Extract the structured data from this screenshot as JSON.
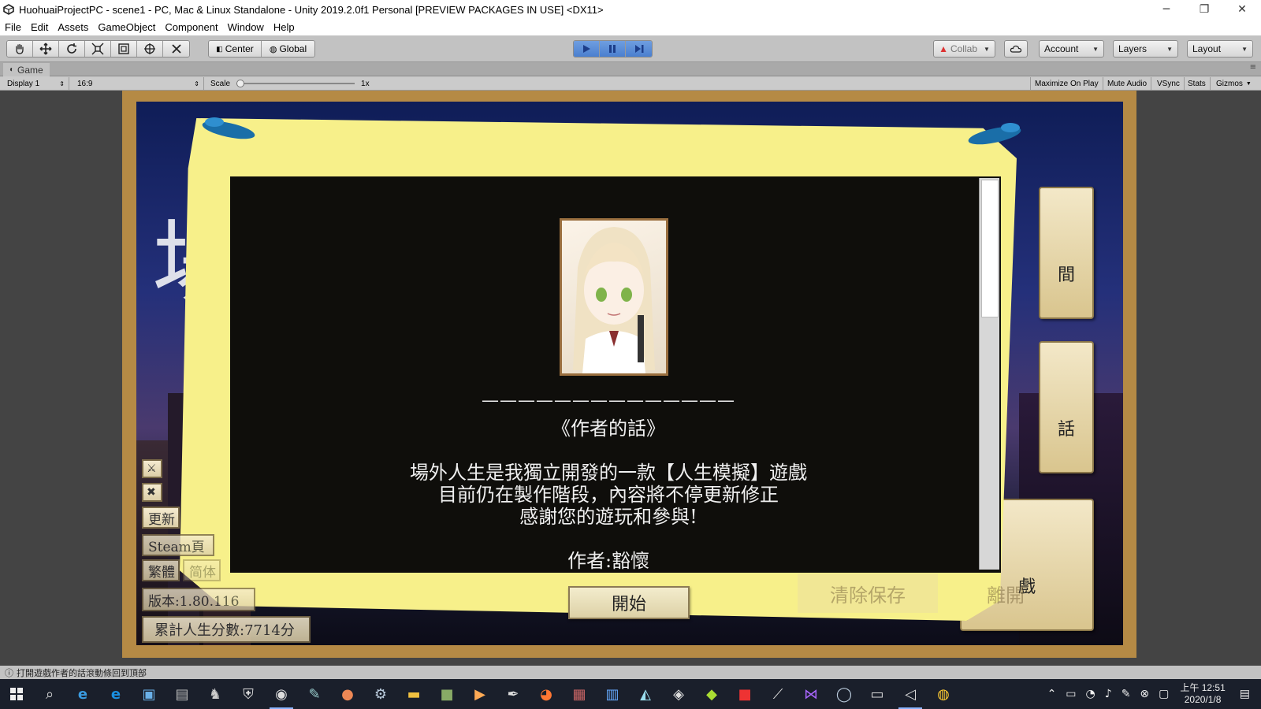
{
  "window": {
    "title": "HuohuaiProjectPC - scene1 - PC, Mac & Linux Standalone - Unity 2019.2.0f1 Personal [PREVIEW PACKAGES IN USE] <DX11>",
    "minimize": "─",
    "restore": "❐",
    "close": "✕"
  },
  "menu": [
    "File",
    "Edit",
    "Assets",
    "GameObject",
    "Component",
    "Window",
    "Help"
  ],
  "toolbar": {
    "tools": [
      "hand-tool",
      "move-tool",
      "rotate-tool",
      "scale-tool",
      "rect-tool",
      "transform-tool",
      "custom-tool"
    ],
    "pivot_label": "Center",
    "space_label": "Global",
    "collab_label": "Collab",
    "account_label": "Account",
    "layers_label": "Layers",
    "layout_label": "Layout",
    "play_state": "playing"
  },
  "game_tab": {
    "label": "Game",
    "display": "Display 1",
    "aspect": "16:9",
    "scale_label": "Scale",
    "scale_value": "1x",
    "options": [
      "Maximize On Play",
      "Mute Audio",
      "VSync",
      "Stats",
      "Gizmos"
    ]
  },
  "game": {
    "side_buttons": [
      {
        "label": "間",
        "icon": "clock-icon"
      },
      {
        "label": "話",
        "icon": "feather-icon"
      },
      {
        "label": "戲",
        "icon": "exit-icon"
      }
    ],
    "bg_button_label": "清除保存",
    "bg_button2_label": "離開",
    "left_buttons": {
      "update": "更新",
      "steam": "Steam頁",
      "trad": "繁體",
      "simp": "简体",
      "version": "版本:1.80.116",
      "score": "累計人生分數:7714分"
    },
    "dialog": {
      "divider": "——————————————",
      "heading": "《作者的話》",
      "line1": "場外人生是我獨立開發的一款【人生模擬】遊戲",
      "line2": "目前仍在製作階段，內容將不停更新修正",
      "line3": "感謝您的遊玩和參與!",
      "author": "作者:豁懷"
    },
    "start_label": "開始"
  },
  "status_text": "打開遊戲作者的話滾動條回到頂部",
  "taskbar": {
    "clock_time": "上午 12:51",
    "clock_date": "2020/1/8"
  }
}
